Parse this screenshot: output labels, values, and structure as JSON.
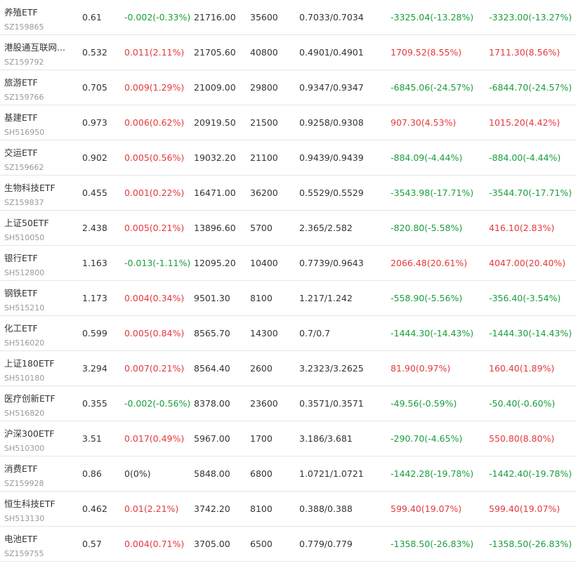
{
  "rows": [
    {
      "name": "养殖ETF",
      "code": "SZ159865",
      "price": "0.61",
      "change": "-0.002(-0.33%)",
      "change_dir": "green",
      "amount": "21716.00",
      "volume": "35600",
      "range": "0.7033/0.7034",
      "pl1": "-3325.04(-13.28%)",
      "pl1_dir": "green",
      "pl2": "-3323.00(-13.27%)",
      "pl2_dir": "green"
    },
    {
      "name": "港股通互联网...",
      "code": "SZ159792",
      "price": "0.532",
      "change": "0.011(2.11%)",
      "change_dir": "red",
      "amount": "21705.60",
      "volume": "40800",
      "range": "0.4901/0.4901",
      "pl1": "1709.52(8.55%)",
      "pl1_dir": "red",
      "pl2": "1711.30(8.56%)",
      "pl2_dir": "red"
    },
    {
      "name": "旅游ETF",
      "code": "SZ159766",
      "price": "0.705",
      "change": "0.009(1.29%)",
      "change_dir": "red",
      "amount": "21009.00",
      "volume": "29800",
      "range": "0.9347/0.9347",
      "pl1": "-6845.06(-24.57%)",
      "pl1_dir": "green",
      "pl2": "-6844.70(-24.57%)",
      "pl2_dir": "green"
    },
    {
      "name": "基建ETF",
      "code": "SH516950",
      "price": "0.973",
      "change": "0.006(0.62%)",
      "change_dir": "red",
      "amount": "20919.50",
      "volume": "21500",
      "range": "0.9258/0.9308",
      "pl1": "907.30(4.53%)",
      "pl1_dir": "red",
      "pl2": "1015.20(4.42%)",
      "pl2_dir": "red"
    },
    {
      "name": "交运ETF",
      "code": "SZ159662",
      "price": "0.902",
      "change": "0.005(0.56%)",
      "change_dir": "red",
      "amount": "19032.20",
      "volume": "21100",
      "range": "0.9439/0.9439",
      "pl1": "-884.09(-4.44%)",
      "pl1_dir": "green",
      "pl2": "-884.00(-4.44%)",
      "pl2_dir": "green"
    },
    {
      "name": "生物科技ETF",
      "code": "SZ159837",
      "price": "0.455",
      "change": "0.001(0.22%)",
      "change_dir": "red",
      "amount": "16471.00",
      "volume": "36200",
      "range": "0.5529/0.5529",
      "pl1": "-3543.98(-17.71%)",
      "pl1_dir": "green",
      "pl2": "-3544.70(-17.71%)",
      "pl2_dir": "green"
    },
    {
      "name": "上证50ETF",
      "code": "SH510050",
      "price": "2.438",
      "change": "0.005(0.21%)",
      "change_dir": "red",
      "amount": "13896.60",
      "volume": "5700",
      "range": "2.365/2.582",
      "pl1": "-820.80(-5.58%)",
      "pl1_dir": "green",
      "pl2": "416.10(2.83%)",
      "pl2_dir": "red"
    },
    {
      "name": "银行ETF",
      "code": "SH512800",
      "price": "1.163",
      "change": "-0.013(-1.11%)",
      "change_dir": "green",
      "amount": "12095.20",
      "volume": "10400",
      "range": "0.7739/0.9643",
      "pl1": "2066.48(20.61%)",
      "pl1_dir": "red",
      "pl2": "4047.00(20.40%)",
      "pl2_dir": "red"
    },
    {
      "name": "钢铁ETF",
      "code": "SH515210",
      "price": "1.173",
      "change": "0.004(0.34%)",
      "change_dir": "red",
      "amount": "9501.30",
      "volume": "8100",
      "range": "1.217/1.242",
      "pl1": "-558.90(-5.56%)",
      "pl1_dir": "green",
      "pl2": "-356.40(-3.54%)",
      "pl2_dir": "green"
    },
    {
      "name": "化工ETF",
      "code": "SH516020",
      "price": "0.599",
      "change": "0.005(0.84%)",
      "change_dir": "red",
      "amount": "8565.70",
      "volume": "14300",
      "range": "0.7/0.7",
      "pl1": "-1444.30(-14.43%)",
      "pl1_dir": "green",
      "pl2": "-1444.30(-14.43%)",
      "pl2_dir": "green"
    },
    {
      "name": "上证180ETF",
      "code": "SH510180",
      "price": "3.294",
      "change": "0.007(0.21%)",
      "change_dir": "red",
      "amount": "8564.40",
      "volume": "2600",
      "range": "3.2323/3.2625",
      "pl1": "81.90(0.97%)",
      "pl1_dir": "red",
      "pl2": "160.40(1.89%)",
      "pl2_dir": "red"
    },
    {
      "name": "医疗创新ETF",
      "code": "SH516820",
      "price": "0.355",
      "change": "-0.002(-0.56%)",
      "change_dir": "green",
      "amount": "8378.00",
      "volume": "23600",
      "range": "0.3571/0.3571",
      "pl1": "-49.56(-0.59%)",
      "pl1_dir": "green",
      "pl2": "-50.40(-0.60%)",
      "pl2_dir": "green"
    },
    {
      "name": "沪深300ETF",
      "code": "SH510300",
      "price": "3.51",
      "change": "0.017(0.49%)",
      "change_dir": "red",
      "amount": "5967.00",
      "volume": "1700",
      "range": "3.186/3.681",
      "pl1": "-290.70(-4.65%)",
      "pl1_dir": "green",
      "pl2": "550.80(8.80%)",
      "pl2_dir": "red"
    },
    {
      "name": "消费ETF",
      "code": "SZ159928",
      "price": "0.86",
      "change": "0(0%)",
      "change_dir": "neutral",
      "amount": "5848.00",
      "volume": "6800",
      "range": "1.0721/1.0721",
      "pl1": "-1442.28(-19.78%)",
      "pl1_dir": "green",
      "pl2": "-1442.40(-19.78%)",
      "pl2_dir": "green"
    },
    {
      "name": "恒生科技ETF",
      "code": "SH513130",
      "price": "0.462",
      "change": "0.01(2.21%)",
      "change_dir": "red",
      "amount": "3742.20",
      "volume": "8100",
      "range": "0.388/0.388",
      "pl1": "599.40(19.07%)",
      "pl1_dir": "red",
      "pl2": "599.40(19.07%)",
      "pl2_dir": "red"
    },
    {
      "name": "电池ETF",
      "code": "SZ159755",
      "price": "0.57",
      "change": "0.004(0.71%)",
      "change_dir": "red",
      "amount": "3705.00",
      "volume": "6500",
      "range": "0.779/0.779",
      "pl1": "-1358.50(-26.83%)",
      "pl1_dir": "green",
      "pl2": "-1358.50(-26.83%)",
      "pl2_dir": "green"
    }
  ],
  "colors": {
    "up": "#e4393c",
    "down": "#1a9e3c",
    "text": "#333333",
    "code": "#999999",
    "divider": "#e6e6e6"
  }
}
